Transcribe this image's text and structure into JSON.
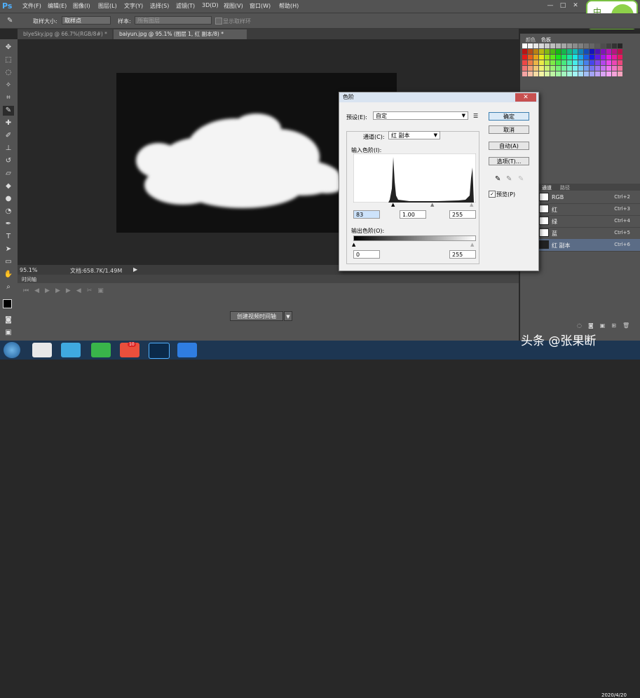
{
  "app": {
    "logo": "Ps"
  },
  "menubar": {
    "items": [
      "文件(F)",
      "编辑(E)",
      "图像(I)",
      "图层(L)",
      "文字(Y)",
      "选择(S)",
      "滤镜(T)",
      "3D(D)",
      "视图(V)",
      "窗口(W)",
      "帮助(H)"
    ],
    "window_controls": [
      "—",
      "□",
      "✕"
    ]
  },
  "options_bar": {
    "sample_size_label": "取样大小:",
    "sample_size_value": "取样点",
    "sample_label": "样本:",
    "sample_value": "所有图层",
    "show_ring_label": "显示取样环"
  },
  "tabs": [
    {
      "label": "blyeSky.jpg @ 66.7%(RGB/8#) *"
    },
    {
      "label": "baiyun.jpg @ 95.1% (图层 1, 红 副本/8) *"
    }
  ],
  "status": {
    "zoom": "95.1%",
    "doc": "文档:658.7K/1.49M"
  },
  "timeline": {
    "title": "时间轴",
    "create_button": "创建视频时间轴"
  },
  "right_panel": {
    "tabs": [
      "颜色",
      "色板"
    ]
  },
  "channels": {
    "tabs": [
      "通道",
      "路径"
    ],
    "rows": [
      {
        "name": "RGB",
        "shortcut": "Ctrl+2"
      },
      {
        "name": "红",
        "shortcut": "Ctrl+3"
      },
      {
        "name": "绿",
        "shortcut": "Ctrl+4"
      },
      {
        "name": "蓝",
        "shortcut": "Ctrl+5"
      },
      {
        "name": "红 副本",
        "shortcut": "Ctrl+6",
        "selected": true
      }
    ]
  },
  "dialog": {
    "title": "色阶",
    "preset_label": "预设(E):",
    "preset_value": "自定",
    "channel_label": "通道(C):",
    "channel_value": "红 副本",
    "input_levels_label": "输入色阶(I):",
    "input_black": "83",
    "input_gamma": "1.00",
    "input_white": "255",
    "output_levels_label": "输出色阶(O):",
    "output_black": "0",
    "output_white": "255",
    "buttons": {
      "ok": "确定",
      "cancel": "取消",
      "auto": "自动(A)",
      "options": "选项(T)..."
    },
    "preview_label": "预览(P)"
  },
  "watermark": {
    "text": "头条 @张果断"
  },
  "taskbar": {
    "date": "2020/4/20",
    "badge_count": "10"
  },
  "colors": {
    "accent": "#4fb0ff",
    "selection": "#5b6c86",
    "dialog_bg": "#f0f0f0",
    "taskbar": "#1d3652"
  }
}
